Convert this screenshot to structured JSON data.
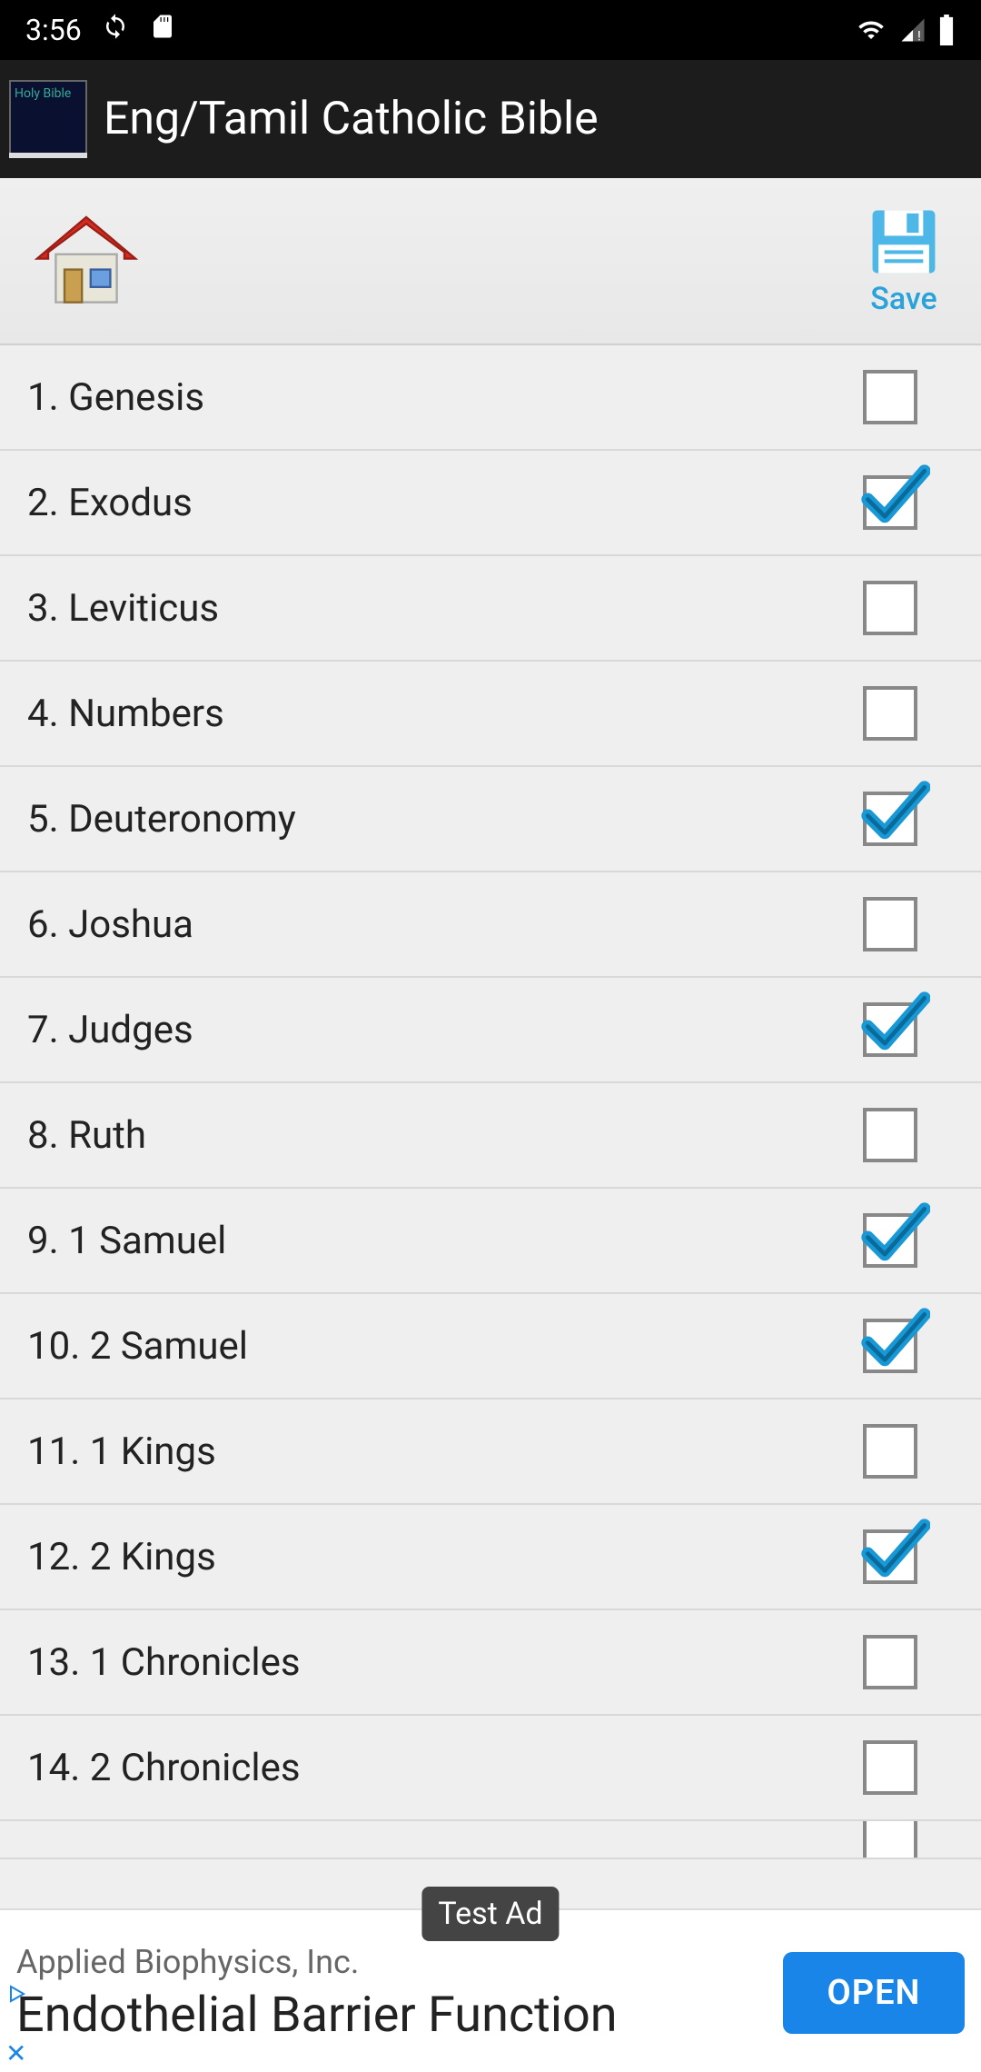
{
  "status": {
    "time": "3:56"
  },
  "app": {
    "title": "Eng/Tamil Catholic Bible",
    "icon_line1": "Holy Bible",
    "icon_line2": ""
  },
  "toolbar": {
    "save_label": "Save"
  },
  "books": [
    {
      "label": "1. Genesis",
      "checked": false
    },
    {
      "label": "2. Exodus",
      "checked": true
    },
    {
      "label": "3. Leviticus",
      "checked": false
    },
    {
      "label": "4. Numbers",
      "checked": false
    },
    {
      "label": "5. Deuteronomy",
      "checked": true
    },
    {
      "label": "6. Joshua",
      "checked": false
    },
    {
      "label": "7. Judges",
      "checked": true
    },
    {
      "label": "8. Ruth",
      "checked": false
    },
    {
      "label": "9. 1 Samuel",
      "checked": true
    },
    {
      "label": "10. 2 Samuel",
      "checked": true
    },
    {
      "label": "11. 1 Kings",
      "checked": false
    },
    {
      "label": "12. 2 Kings",
      "checked": true
    },
    {
      "label": "13. 1 Chronicles",
      "checked": false
    },
    {
      "label": "14. 2 Chronicles",
      "checked": false
    }
  ],
  "ad": {
    "badge": "Test Ad",
    "advertiser": "Applied Biophysics, Inc.",
    "headline": "Endothelial Barrier Function",
    "cta": "OPEN"
  }
}
